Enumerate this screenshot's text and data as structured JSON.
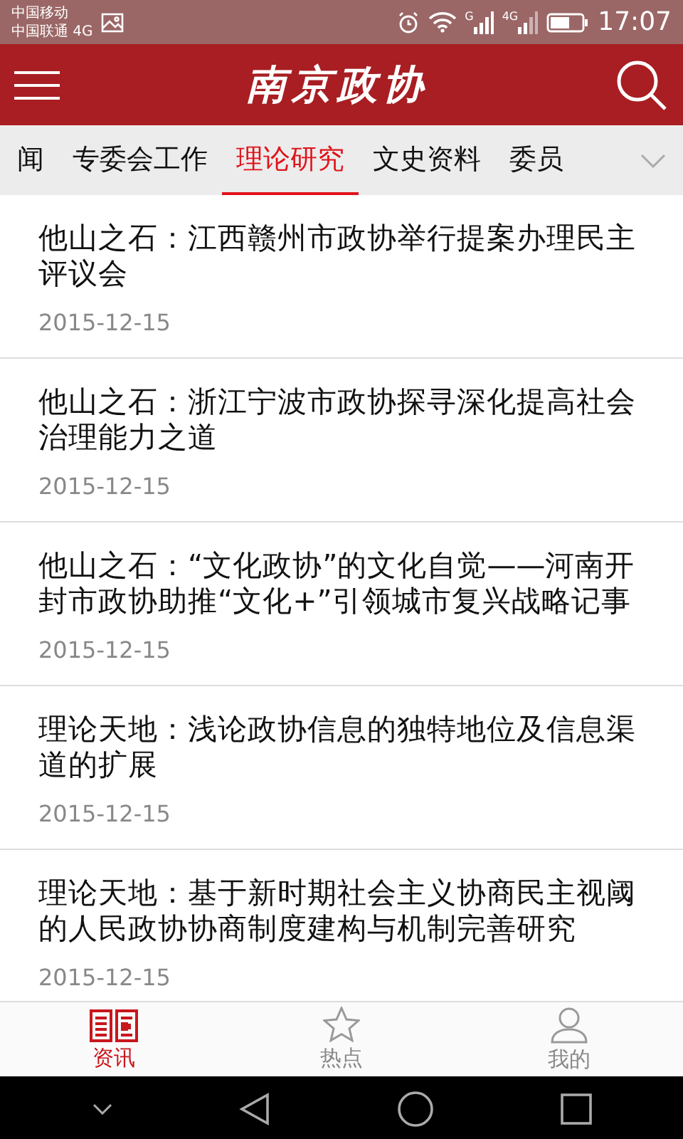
{
  "status_bar": {
    "carrier_1": "中国移动",
    "carrier_2": "中国联通 4G",
    "signal_1_label": "G",
    "signal_2_label": "4G",
    "time": "17:07"
  },
  "header": {
    "title": "南京政协"
  },
  "tabs": [
    {
      "label": "闻",
      "selected": false
    },
    {
      "label": "专委会工作",
      "selected": false
    },
    {
      "label": "理论研究",
      "selected": true
    },
    {
      "label": "文史资料",
      "selected": false
    },
    {
      "label": "委员",
      "selected": false
    }
  ],
  "articles": [
    {
      "title": "他山之石：江西赣州市政协举行提案办理民主评议会",
      "date": "2015-12-15"
    },
    {
      "title": "他山之石：浙江宁波市政协探寻深化提高社会治理能力之道",
      "date": "2015-12-15"
    },
    {
      "title": "他山之石：“文化政协”的文化自觉——河南开封市政协助推“文化+”引领城市复兴战略记事",
      "date": "2015-12-15"
    },
    {
      "title": "理论天地：浅论政协信息的独特地位及信息渠道的扩展",
      "date": "2015-12-15"
    },
    {
      "title": "理论天地：基于新时期社会主义协商民主视阈的人民政协协商制度建构与机制完善研究",
      "date": "2015-12-15"
    }
  ],
  "bottom_nav": [
    {
      "kind": "news",
      "label": "资讯",
      "selected": true
    },
    {
      "kind": "star",
      "label": "热点",
      "selected": false
    },
    {
      "kind": "person",
      "label": "我的",
      "selected": false
    }
  ]
}
